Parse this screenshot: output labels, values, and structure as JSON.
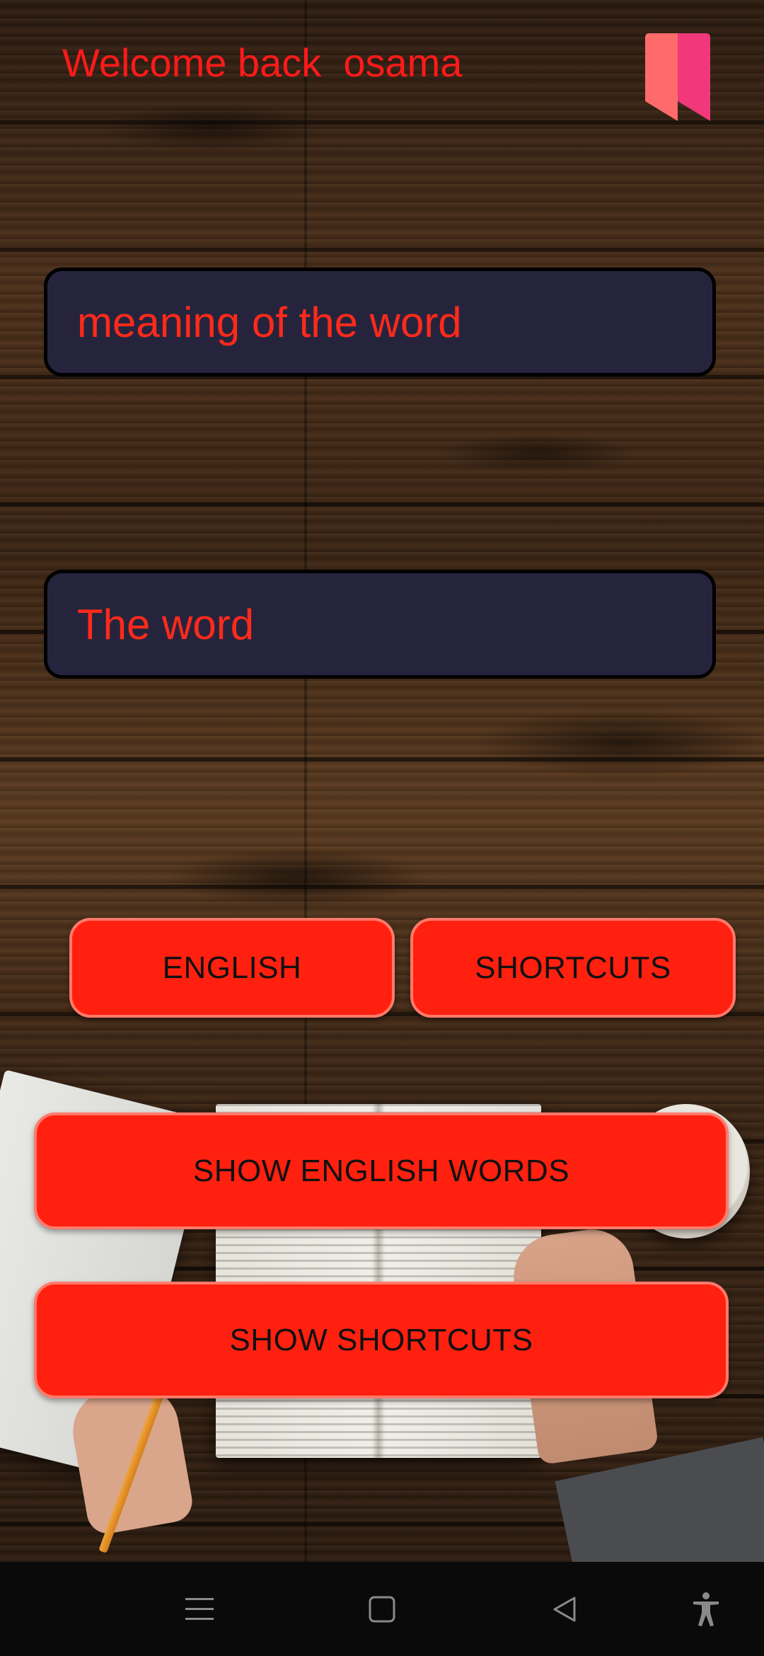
{
  "header": {
    "welcome_text": "Welcome back  osama",
    "bookmark_icon": "bookmark-icon"
  },
  "fields": {
    "meaning_placeholder": "meaning of the word",
    "word_placeholder": "The word"
  },
  "buttons": {
    "english": "ENGLISH",
    "shortcuts": "SHORTCUTS",
    "show_english_words": "SHOW ENGLISH WORDS",
    "show_shortcuts": "SHOW SHORTCUTS"
  },
  "navbar": {
    "icons": [
      "menu-icon",
      "home-icon",
      "back-icon",
      "accessibility-icon"
    ]
  },
  "colors": {
    "accent": "#ff2010",
    "text_red": "#ff1a1a",
    "field_bg": "#26243d",
    "bookmark_left": "#ff6b6b",
    "bookmark_right": "#f0387a"
  }
}
